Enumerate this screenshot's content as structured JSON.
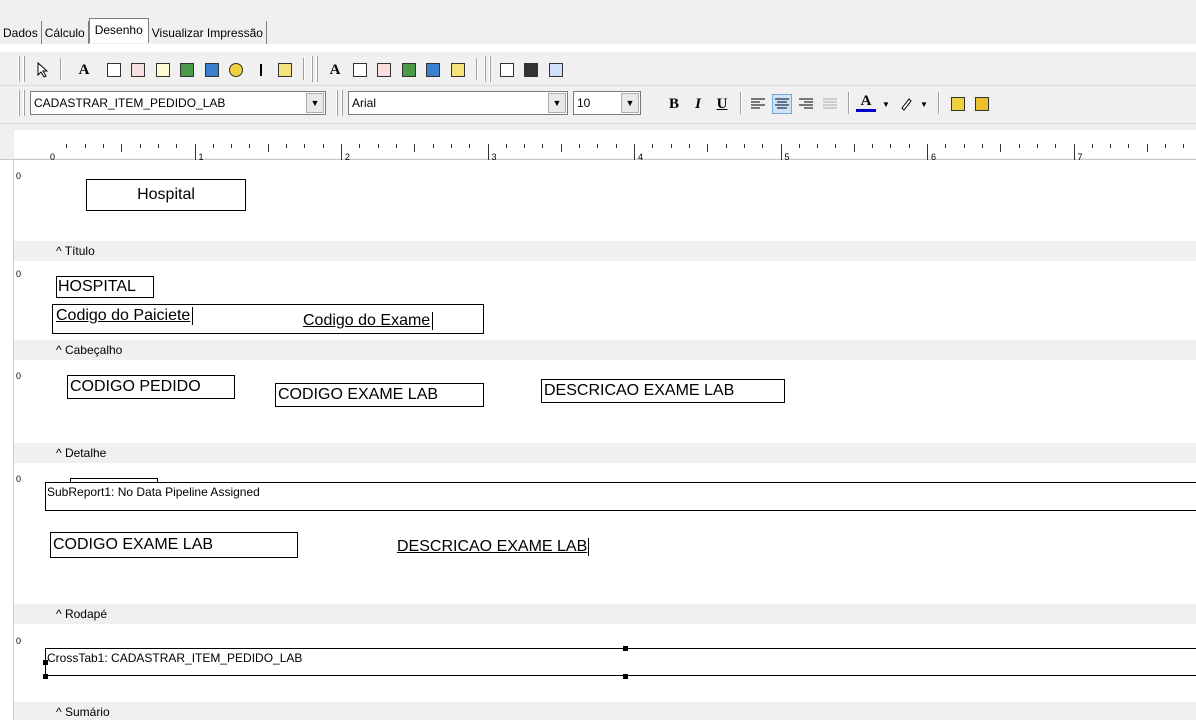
{
  "tabs": [
    {
      "label": "Dados"
    },
    {
      "label": "Cálculo"
    },
    {
      "label": "Desenho"
    },
    {
      "label": "Visualizar Impressão"
    }
  ],
  "toolbar2": {
    "datasource": "CADASTRAR_ITEM_PEDIDO_LAB",
    "font": "Arial",
    "size": "10",
    "bold": "B",
    "italic": "I",
    "underline": "U",
    "font_color": "A"
  },
  "ruler": {
    "labels": [
      "0",
      "1",
      "2",
      "3",
      "4",
      "5",
      "6",
      "7"
    ]
  },
  "bands": {
    "titulo": "^ Título",
    "cabecalho": "^ Cabeçalho",
    "detalhe": "^ Detalhe",
    "rodape": "^ Rodapé",
    "sumario": "^ Sumário"
  },
  "vertical_marks": {
    "zero": "0"
  },
  "components": {
    "hospital_title": "Hospital",
    "hospital_caps": "HOSPITAL",
    "codigo_paciente": "Codigo do Paiciete",
    "codigo_exame": "Codigo do Exame",
    "codigo_pedido": "CODIGO PEDIDO",
    "codigo_exame_lab": "CODIGO EXAME LAB",
    "descricao_exame_lab": "DESCRICAO EXAME LAB",
    "subreport": "SubReport1: No Data Pipeline Assigned",
    "codigo_exame_lab_2": "CODIGO EXAME LAB",
    "descricao_exame_lab_2": "DESCRICAO EXAME LAB",
    "crosstab": "CrossTab1: CADASTRAR_ITEM_PEDIDO_LAB"
  }
}
